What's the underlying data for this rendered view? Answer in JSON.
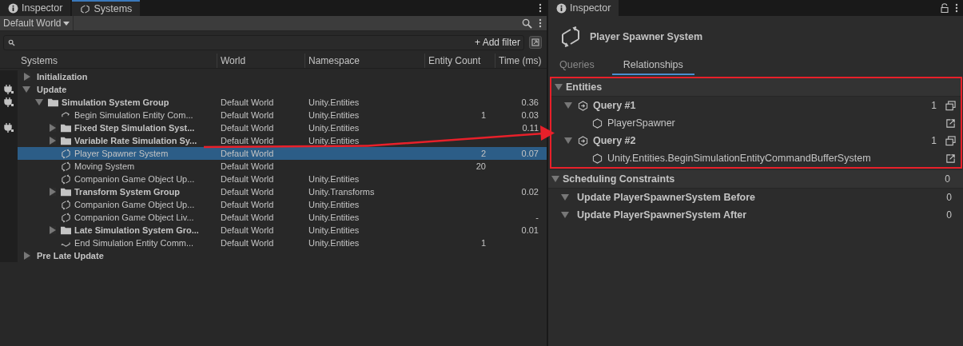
{
  "left_tabs": [
    {
      "label": "Inspector",
      "selected": false
    },
    {
      "label": "Systems",
      "selected": true
    }
  ],
  "world_dropdown": {
    "value": "Default World"
  },
  "add_filter": {
    "label": "+ Add filter"
  },
  "columns": [
    "Systems",
    "World",
    "Namespace",
    "Entity Count",
    "Time (ms)"
  ],
  "rows": [
    {
      "kind": "root",
      "name": "Initialization",
      "expanded": false,
      "plugged": false,
      "selected": false
    },
    {
      "kind": "root",
      "name": "Update",
      "expanded": true,
      "plugged": true,
      "selected": false,
      "children": [
        {
          "kind": "group",
          "name": "Simulation System Group",
          "world": "Default World",
          "namespace": "Unity.Entities",
          "time": "0.36",
          "expanded": true,
          "plugged": true,
          "selected": false,
          "children": [
            {
              "kind": "begin-buffer",
              "name": "Begin Simulation Entity Com...",
              "world": "Default World",
              "namespace": "Unity.Entities",
              "count": "1",
              "time": "0.03",
              "plugged": false,
              "selected": false
            },
            {
              "kind": "group",
              "name": "Fixed Step Simulation Syst...",
              "world": "Default World",
              "namespace": "Unity.Entities",
              "time": "0.11",
              "expanded": false,
              "plugged": true,
              "selected": false
            },
            {
              "kind": "group",
              "name": "Variable Rate Simulation Sy...",
              "world": "Default World",
              "namespace": "Unity.Entities",
              "expanded": false,
              "plugged": false,
              "selected": false
            },
            {
              "kind": "system",
              "name": "Player Spawner System",
              "world": "Default World",
              "count": "2",
              "time": "0.07",
              "plugged": false,
              "selected": true
            },
            {
              "kind": "system",
              "name": "Moving System",
              "world": "Default World",
              "count": "20",
              "plugged": false,
              "selected": false
            },
            {
              "kind": "system",
              "name": "Companion Game Object Up...",
              "world": "Default World",
              "namespace": "Unity.Entities",
              "plugged": false,
              "selected": false
            },
            {
              "kind": "group",
              "name": "Transform System Group",
              "world": "Default World",
              "namespace": "Unity.Transforms",
              "time": "0.02",
              "expanded": false,
              "plugged": false,
              "selected": false
            },
            {
              "kind": "system",
              "name": "Companion Game Object Up...",
              "world": "Default World",
              "namespace": "Unity.Entities",
              "plugged": false,
              "selected": false
            },
            {
              "kind": "system",
              "name": "Companion Game Object Liv...",
              "world": "Default World",
              "namespace": "Unity.Entities",
              "time": "-",
              "plugged": false,
              "selected": false
            },
            {
              "kind": "group",
              "name": "Late Simulation System Gro...",
              "world": "Default World",
              "namespace": "Unity.Entities",
              "time": "0.01",
              "expanded": false,
              "plugged": false,
              "selected": false
            },
            {
              "kind": "end-buffer",
              "name": "End Simulation Entity Comm...",
              "world": "Default World",
              "namespace": "Unity.Entities",
              "count": "1",
              "plugged": false,
              "selected": false
            }
          ]
        }
      ]
    },
    {
      "kind": "root",
      "name": "Pre Late Update",
      "expanded": false,
      "plugged": false,
      "selected": false
    }
  ],
  "inspector": {
    "tab": "Inspector",
    "title": "Player Spawner System",
    "tabs": [
      {
        "label": "Queries",
        "selected": false
      },
      {
        "label": "Relationships",
        "selected": true
      }
    ],
    "sections": [
      {
        "title": "Entities",
        "expanded": true,
        "highlighted": true,
        "items": [
          {
            "kind": "query",
            "title": "Query #1",
            "count": "1",
            "expanded": true,
            "children": [
              {
                "kind": "entity",
                "title": "PlayerSpawner"
              }
            ]
          },
          {
            "kind": "query",
            "title": "Query #2",
            "count": "1",
            "expanded": true,
            "children": [
              {
                "kind": "entity",
                "title": "Unity.Entities.BeginSimulationEntityCommandBufferSystem"
              }
            ]
          }
        ]
      },
      {
        "title": "Scheduling Constraints",
        "count": "0",
        "expanded": true,
        "highlighted": false,
        "items": [
          {
            "kind": "constraint",
            "title": "Update PlayerSpawnerSystem Before",
            "count": "0",
            "expanded": true
          },
          {
            "kind": "constraint",
            "title": "Update PlayerSpawnerSystem After",
            "count": "0",
            "expanded": true
          }
        ]
      }
    ]
  }
}
